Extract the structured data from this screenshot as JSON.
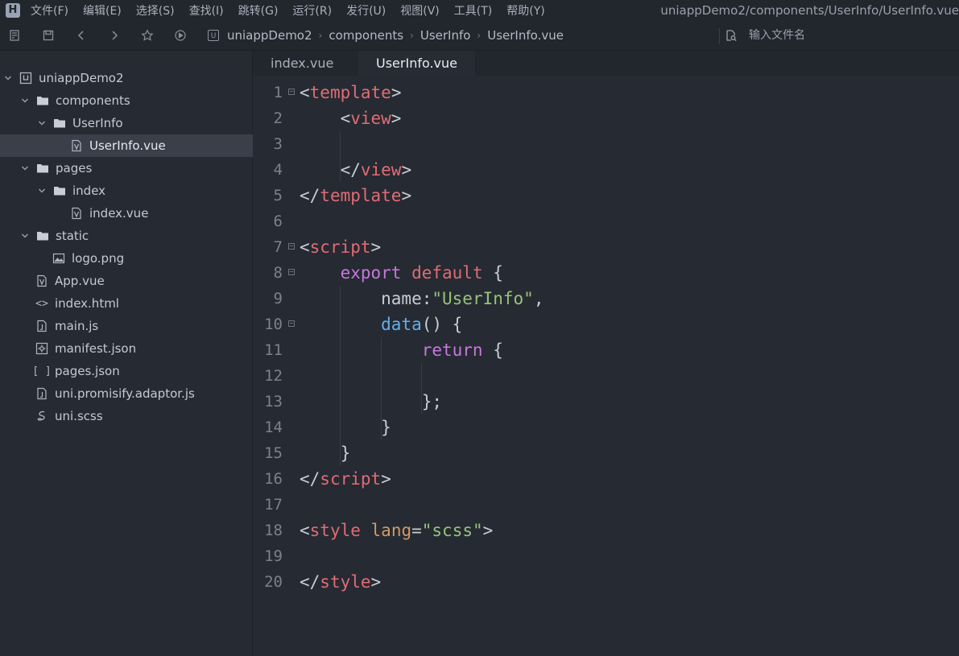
{
  "app": {
    "logo_letter": "H",
    "window_title": "uniappDemo2/components/UserInfo/UserInfo.vue"
  },
  "menu": [
    "文件(F)",
    "编辑(E)",
    "选择(S)",
    "查找(I)",
    "跳转(G)",
    "运行(R)",
    "发行(U)",
    "视图(V)",
    "工具(T)",
    "帮助(Y)"
  ],
  "toolbar": {
    "buttons": [
      "open-project-icon",
      "save-icon",
      "back-icon",
      "forward-icon",
      "star-icon",
      "run-icon"
    ],
    "breadcrumb": [
      "uniappDemo2",
      "components",
      "UserInfo",
      "UserInfo.vue"
    ],
    "root_badge": "U",
    "search_placeholder": "输入文件名"
  },
  "sidebar": {
    "tree": [
      {
        "label": "uniappDemo2",
        "icon": "project-icon",
        "expanded": true
      },
      {
        "label": "components",
        "icon": "folder-icon",
        "expanded": true
      },
      {
        "label": "UserInfo",
        "icon": "folder-icon",
        "expanded": true
      },
      {
        "label": "UserInfo.vue",
        "icon": "vue-file-icon",
        "selected": true
      },
      {
        "label": "pages",
        "icon": "folder-icon",
        "expanded": true
      },
      {
        "label": "index",
        "icon": "folder-icon",
        "expanded": true
      },
      {
        "label": "index.vue",
        "icon": "vue-file-icon"
      },
      {
        "label": "static",
        "icon": "folder-icon",
        "expanded": true
      },
      {
        "label": "logo.png",
        "icon": "image-file-icon"
      },
      {
        "label": "App.vue",
        "icon": "vue-file-icon"
      },
      {
        "label": "index.html",
        "icon": "html-file-icon"
      },
      {
        "label": "main.js",
        "icon": "js-file-icon"
      },
      {
        "label": "manifest.json",
        "icon": "manifest-file-icon"
      },
      {
        "label": "pages.json",
        "icon": "json-file-icon"
      },
      {
        "label": "uni.promisify.adaptor.js",
        "icon": "js-file-icon"
      },
      {
        "label": "uni.scss",
        "icon": "scss-file-icon"
      }
    ],
    "html_glyph": "<>",
    "json_glyph": "[ ]"
  },
  "editor": {
    "tabs": [
      {
        "label": "index.vue",
        "active": false
      },
      {
        "label": "UserInfo.vue",
        "active": true
      }
    ],
    "lines": [
      {
        "n": "1",
        "fold": true,
        "tokens": [
          [
            "plain",
            "<"
          ],
          [
            "tag",
            "template"
          ],
          [
            "plain",
            ">"
          ]
        ]
      },
      {
        "n": "2",
        "tokens": [
          [
            "plain",
            "    <"
          ],
          [
            "tag",
            "view"
          ],
          [
            "plain",
            ">"
          ]
        ]
      },
      {
        "n": "3",
        "tokens": []
      },
      {
        "n": "4",
        "tokens": [
          [
            "plain",
            "    </"
          ],
          [
            "tag",
            "view"
          ],
          [
            "plain",
            ">"
          ]
        ]
      },
      {
        "n": "5",
        "tokens": [
          [
            "plain",
            "</"
          ],
          [
            "tag",
            "template"
          ],
          [
            "plain",
            ">"
          ]
        ]
      },
      {
        "n": "6",
        "tokens": []
      },
      {
        "n": "7",
        "fold": true,
        "tokens": [
          [
            "plain",
            "<"
          ],
          [
            "tag",
            "script"
          ],
          [
            "plain",
            ">"
          ]
        ]
      },
      {
        "n": "8",
        "fold": true,
        "tokens": [
          [
            "plain",
            "    "
          ],
          [
            "kw",
            "export"
          ],
          [
            "plain",
            " "
          ],
          [
            "tag",
            "default"
          ],
          [
            "plain",
            " {"
          ]
        ]
      },
      {
        "n": "9",
        "tokens": [
          [
            "plain",
            "        name:"
          ],
          [
            "str",
            "\"UserInfo\""
          ],
          [
            "plain",
            ","
          ]
        ]
      },
      {
        "n": "10",
        "fold": true,
        "tokens": [
          [
            "plain",
            "        "
          ],
          [
            "fn",
            "data"
          ],
          [
            "plain",
            "() {"
          ]
        ]
      },
      {
        "n": "11",
        "tokens": [
          [
            "plain",
            "            "
          ],
          [
            "kw",
            "return"
          ],
          [
            "plain",
            " {"
          ]
        ]
      },
      {
        "n": "12",
        "tokens": []
      },
      {
        "n": "13",
        "tokens": [
          [
            "plain",
            "            };"
          ]
        ]
      },
      {
        "n": "14",
        "tokens": [
          [
            "plain",
            "        }"
          ]
        ]
      },
      {
        "n": "15",
        "tokens": [
          [
            "plain",
            "    }"
          ]
        ]
      },
      {
        "n": "16",
        "tokens": [
          [
            "plain",
            "</"
          ],
          [
            "tag",
            "script"
          ],
          [
            "plain",
            ">"
          ]
        ]
      },
      {
        "n": "17",
        "tokens": []
      },
      {
        "n": "18",
        "tokens": [
          [
            "plain",
            "<"
          ],
          [
            "tag",
            "style"
          ],
          [
            "plain",
            " "
          ],
          [
            "attr",
            "lang"
          ],
          [
            "plain",
            "="
          ],
          [
            "str",
            "\"scss\""
          ],
          [
            "plain",
            ">"
          ]
        ]
      },
      {
        "n": "19",
        "tokens": []
      },
      {
        "n": "20",
        "tokens": [
          [
            "plain",
            "</"
          ],
          [
            "tag",
            "style"
          ],
          [
            "plain",
            ">"
          ]
        ]
      }
    ]
  },
  "colors": {
    "background": "#262a32",
    "tag": "#e06c75",
    "keyword": "#c678dd",
    "string": "#98c379",
    "function": "#61afef",
    "attribute": "#d19a66"
  }
}
